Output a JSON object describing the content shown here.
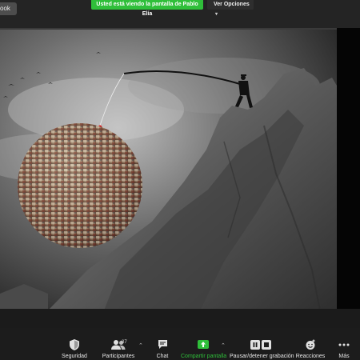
{
  "topbar": {
    "left_pill": "ook",
    "share_banner": "Usted está viendo la pantalla de Pablo Elía",
    "view_options": "Ver Opciones",
    "view_options_chevron": "chevron-down-icon"
  },
  "shared_content": {
    "image_alt": "surreal photo of a man with a fishing rod on a rocky mountain pulling a large sphere made of books"
  },
  "toolbar": {
    "security": "Seguridad",
    "participants": "Participantes",
    "participants_count": "87",
    "chat": "Chat",
    "share_screen": "Compartir pantalla",
    "record": "Pausar/detener grabación",
    "reactions": "Reacciones",
    "more": "Más"
  },
  "colors": {
    "accent_green": "#2fbf3a",
    "toolbar_bg": "#1c1c1c",
    "topbar_bg": "#242424"
  }
}
